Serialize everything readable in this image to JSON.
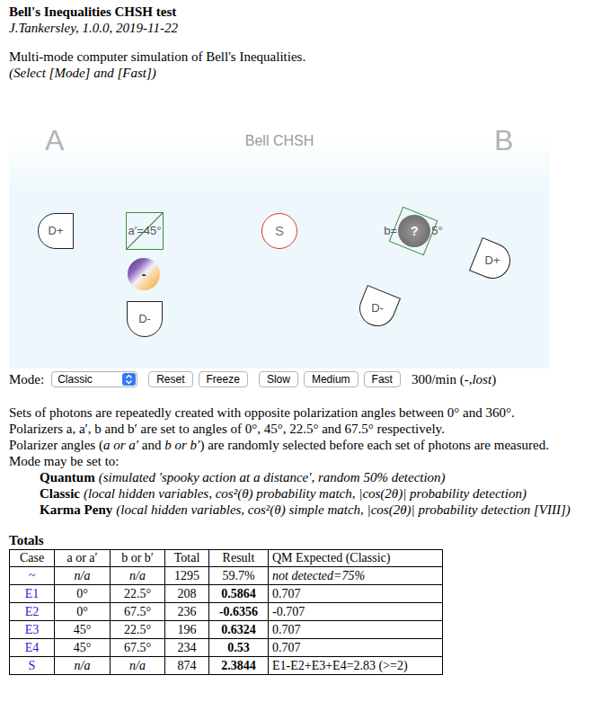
{
  "header": {
    "title": "Bell's Inequalities CHSH test",
    "author": "J.Tankersley, 1.0.0, 2019-11-22"
  },
  "intro": [
    "Multi-mode computer simulation of Bell's Inequalities.",
    "(Select [Mode] and [Fast])"
  ],
  "canvas": {
    "side_a": "A",
    "title": "Bell CHSH",
    "side_b": "B",
    "source": "S",
    "a": {
      "detector_plus": "D+",
      "detector_minus": "D-",
      "polarizer": "a′=45°",
      "photon": "-"
    },
    "b": {
      "detector_plus": "D+",
      "detector_minus": "D-",
      "polarizer_start": "b=",
      "photon": "?",
      "polarizer_end": "5°"
    }
  },
  "controls": {
    "mode_label": "Mode:",
    "mode": "Classic",
    "buttons": [
      "Reset",
      "Freeze",
      "Slow",
      "Medium",
      "Fast"
    ],
    "rate": "300/min (-,",
    "rate_note": "lost",
    "rate_end": ")"
  },
  "description": [
    [
      {
        "text": "Sets of photons are repeatedly created with opposite polarization angles between 0° and 360°.",
        "italic": false
      }
    ],
    [
      {
        "text": "Polarizers a, a′, b and b′ are set to angles of 0°, 45°, 22.5° and 67.5° respectively.",
        "italic": false
      }
    ],
    [
      {
        "text": "Polarizer angles (",
        "italic": false
      },
      {
        "text": "a or a′",
        "italic": true
      },
      {
        "text": " and ",
        "italic": false
      },
      {
        "text": "b or b′",
        "italic": true
      },
      {
        "text": ") are randomly selected before each set of photons are measured.",
        "italic": false
      }
    ],
    [
      {
        "text": "Mode may be set to:",
        "italic": false
      }
    ]
  ],
  "modes": [
    {
      "name": "Quantum",
      "detail": "(simulated 'spooky action at a distance', random 50% detection)"
    },
    {
      "name": "Classic",
      "detail": "(local hidden variables, cos²(θ) probability match, |cos(2θ)| probability detection)"
    },
    {
      "name": "Karma Peny",
      "detail": "(local hidden variables, cos²(θ) simple match, |cos(2θ)| probability detection [VIII])"
    }
  ],
  "totals": {
    "title": "Totals",
    "columns": [
      "Case",
      "a or a′",
      "b or b′",
      "Total",
      "Result",
      "QM Expected (Classic)"
    ],
    "rows": [
      {
        "case": "~",
        "a": "n/a",
        "b": "n/a",
        "total": "1295",
        "result": "59.7%",
        "expected": "not detected=75%",
        "angles_italic": true,
        "result_bold": false,
        "expected_italic": true
      },
      {
        "case": "E1",
        "a": "0°",
        "b": "22.5°",
        "total": "208",
        "result": "0.5864",
        "expected": "0.707",
        "angles_italic": false,
        "result_bold": true,
        "expected_italic": false
      },
      {
        "case": "E2",
        "a": "0°",
        "b": "67.5°",
        "total": "236",
        "result": "-0.6356",
        "expected": "-0.707",
        "angles_italic": false,
        "result_bold": true,
        "expected_italic": false
      },
      {
        "case": "E3",
        "a": "45°",
        "b": "22.5°",
        "total": "196",
        "result": "0.6324",
        "expected": "0.707",
        "angles_italic": false,
        "result_bold": true,
        "expected_italic": false
      },
      {
        "case": "E4",
        "a": "45°",
        "b": "67.5°",
        "total": "234",
        "result": "0.53",
        "expected": "0.707",
        "angles_italic": false,
        "result_bold": true,
        "expected_italic": false
      },
      {
        "case": "S",
        "a": "n/a",
        "b": "n/a",
        "total": "874",
        "result": "2.3844",
        "expected": "E1-E2+E3+E4=2.83 (>=2)",
        "angles_italic": true,
        "result_bold": true,
        "expected_italic": false
      }
    ]
  }
}
